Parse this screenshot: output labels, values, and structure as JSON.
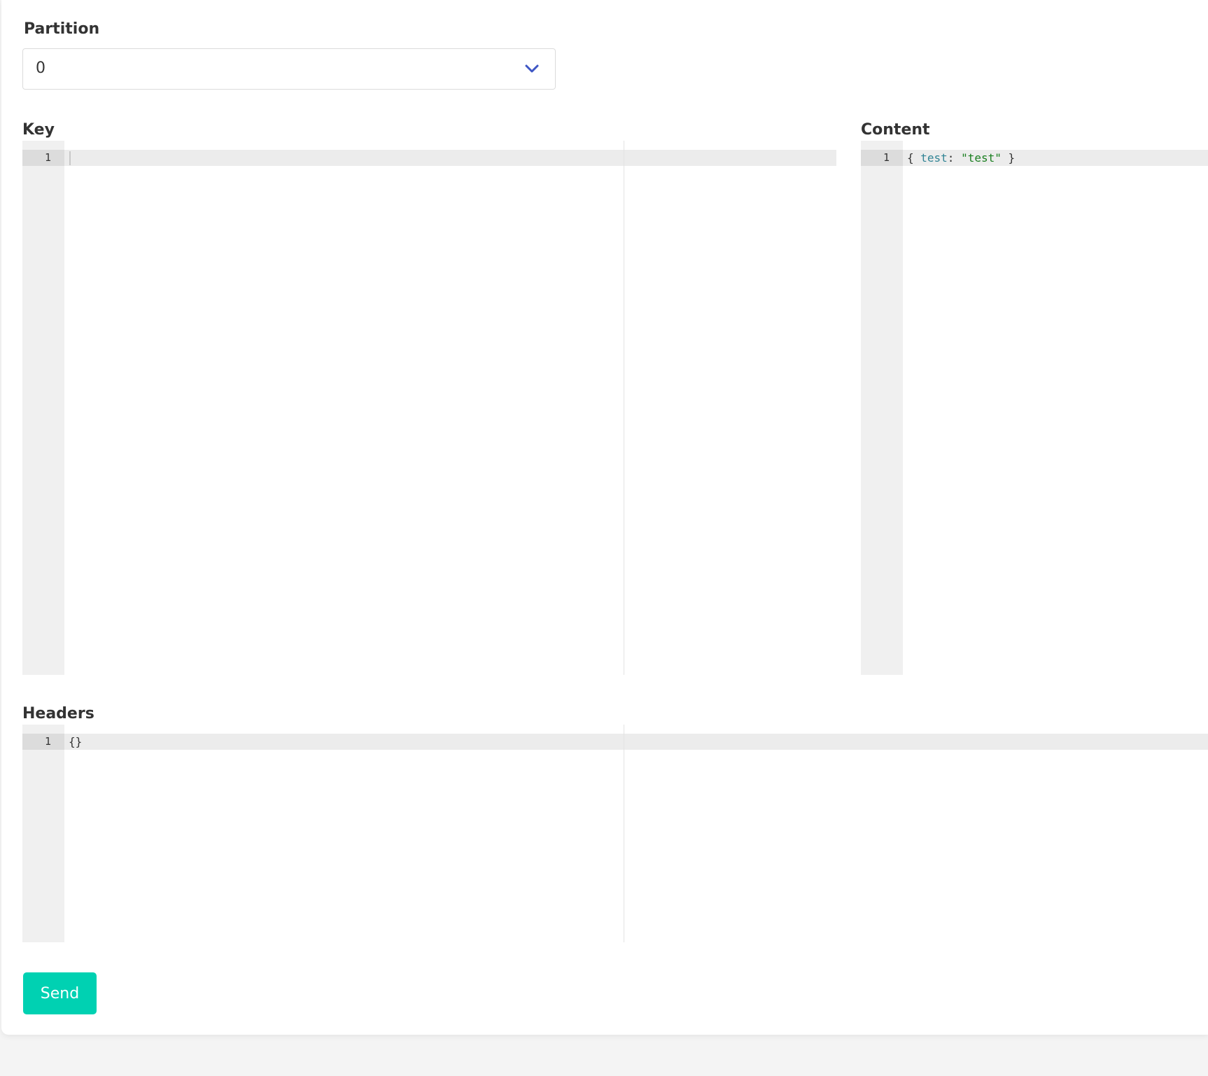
{
  "form": {
    "partition": {
      "label": "Partition",
      "selected_value": "0",
      "icon": "chevron-down-icon",
      "accent_color": "#3e56c4"
    },
    "key": {
      "label": "Key",
      "line_number": "1",
      "content": ""
    },
    "content": {
      "label": "Content",
      "line_number": "1",
      "tokens": {
        "open": "{ ",
        "key": "test",
        "colon": ": ",
        "value": "\"test\"",
        "close": " }"
      }
    },
    "headers": {
      "label": "Headers",
      "line_number": "1",
      "content": "{}"
    },
    "send_button": {
      "label": "Send",
      "color": "#00d1b2"
    }
  }
}
